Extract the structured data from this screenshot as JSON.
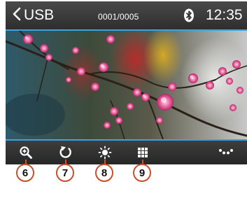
{
  "header": {
    "title": "USB",
    "counter": "0001/0005",
    "clock": "12:35"
  },
  "icons": {
    "back": "chevron-left-icon",
    "bluetooth": "bluetooth-icon",
    "zoom": "zoom-in-icon",
    "rotate": "rotate-icon",
    "brightness": "brightness-icon",
    "grid": "grid-view-icon",
    "more": "more-options-icon"
  },
  "callouts": [
    "6",
    "7",
    "8",
    "9"
  ],
  "colors": {
    "accent_line": "#3aa3e0",
    "callout_ring": "#c8502a"
  }
}
